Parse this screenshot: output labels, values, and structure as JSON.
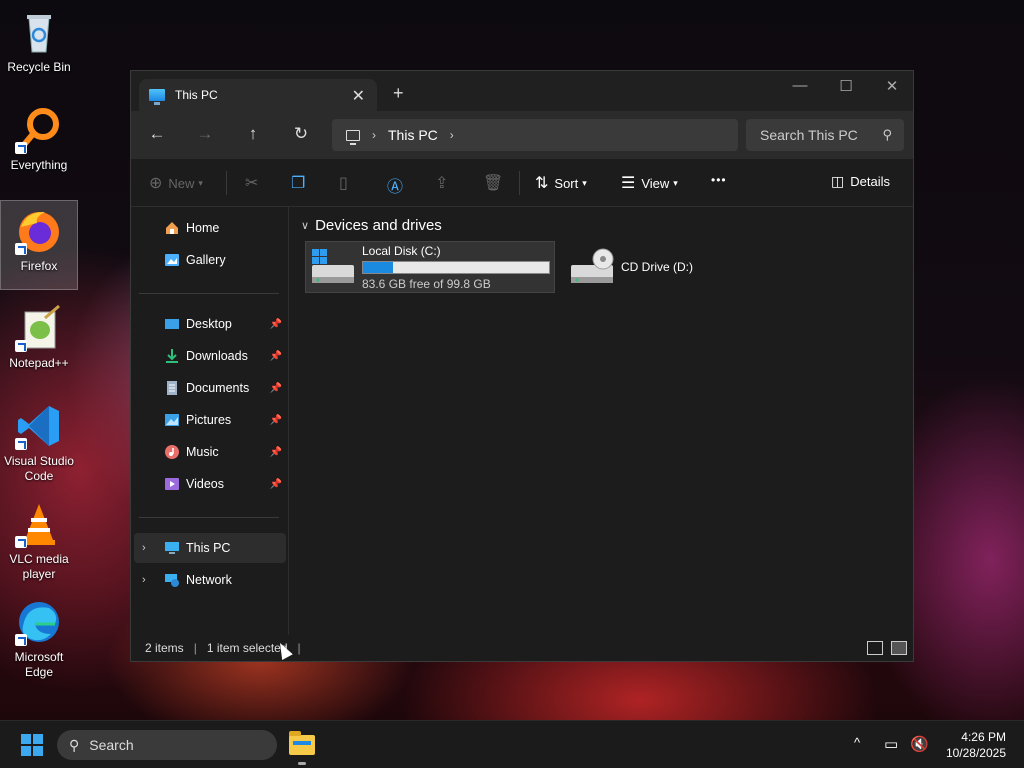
{
  "desktop": {
    "icons": [
      {
        "label": "Recycle Bin",
        "icon": "recycle-bin-icon"
      },
      {
        "label": "Everything",
        "icon": "everything-search-icon"
      },
      {
        "label": "Firefox",
        "icon": "firefox-icon"
      },
      {
        "label": "Notepad++",
        "icon": "notepad-plus-plus-icon"
      },
      {
        "label": "Visual Studio Code",
        "icon": "vscode-icon"
      },
      {
        "label": "VLC media player",
        "icon": "vlc-icon"
      },
      {
        "label": "Microsoft Edge",
        "icon": "edge-icon"
      }
    ]
  },
  "window": {
    "tab_title": "This PC",
    "new_tab_glyph": "+",
    "controls": {
      "minimize": "—",
      "maximize": "☐",
      "close": "✕"
    },
    "nav": {
      "back": "←",
      "forward": "→",
      "up": "↑",
      "refresh": "↻"
    },
    "address": {
      "location": "This PC",
      "sep": "›"
    },
    "search": {
      "placeholder": "Search This PC"
    },
    "commands": {
      "new": "New",
      "sort": "Sort",
      "view": "View",
      "more": "•••",
      "details": "Details"
    },
    "sidebar": {
      "home": "Home",
      "gallery": "Gallery",
      "quick_access": [
        {
          "label": "Desktop",
          "icon": "desktop-folder-icon"
        },
        {
          "label": "Downloads",
          "icon": "downloads-folder-icon"
        },
        {
          "label": "Documents",
          "icon": "documents-folder-icon"
        },
        {
          "label": "Pictures",
          "icon": "pictures-folder-icon"
        },
        {
          "label": "Music",
          "icon": "music-folder-icon"
        },
        {
          "label": "Videos",
          "icon": "videos-folder-icon"
        }
      ],
      "this_pc": "This PC",
      "network": "Network"
    },
    "content": {
      "group_title": "Devices and drives",
      "drives": [
        {
          "name": "Local Disk (C:)",
          "free_text": "83.6 GB free of 99.8 GB",
          "used_fraction": 0.162,
          "selected": true
        },
        {
          "name": "CD Drive (D:)",
          "selected": false
        }
      ]
    },
    "status": {
      "items": "2 items",
      "selected": "1 item selected"
    }
  },
  "taskbar": {
    "search_label": "Search",
    "time": "4:26 PM",
    "date": "10/28/2025",
    "tray_chevron": "^"
  },
  "colors": {
    "accent": "#1a8ae0",
    "window_bg": "#1c1c1c",
    "taskbar_bg": "#1b1b1b"
  }
}
